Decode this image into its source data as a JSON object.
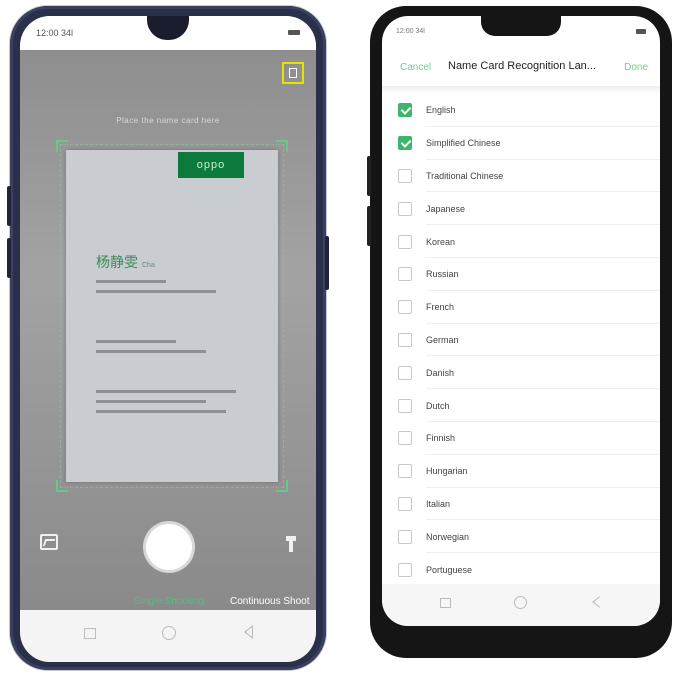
{
  "left_phone": {
    "status_time": "12:00 34l",
    "hint_text": "Place the name card here",
    "card": {
      "brand": "oppo",
      "name": "杨静雯",
      "name_suffix": "Cha"
    },
    "modes": {
      "single": "Single Shooting",
      "continuous": "Continuous Shoot"
    }
  },
  "right_phone": {
    "status_time": "12:00 34l",
    "cancel_label": "Cancel",
    "title": "Name Card Recognition Lan...",
    "done_label": "Done",
    "languages": [
      {
        "label": "English",
        "checked": true
      },
      {
        "label": "Simplified Chinese",
        "checked": true
      },
      {
        "label": "Traditional Chinese",
        "checked": false
      },
      {
        "label": "Japanese",
        "checked": false
      },
      {
        "label": "Korean",
        "checked": false
      },
      {
        "label": "Russian",
        "checked": false
      },
      {
        "label": "French",
        "checked": false
      },
      {
        "label": "German",
        "checked": false
      },
      {
        "label": "Danish",
        "checked": false
      },
      {
        "label": "Dutch",
        "checked": false
      },
      {
        "label": "Finnish",
        "checked": false
      },
      {
        "label": "Hungarian",
        "checked": false
      },
      {
        "label": "Italian",
        "checked": false
      },
      {
        "label": "Norwegian",
        "checked": false
      },
      {
        "label": "Portuguese",
        "checked": false
      }
    ]
  },
  "colors": {
    "accent_green": "#3bb66a",
    "highlight_yellow": "#e8e200"
  }
}
